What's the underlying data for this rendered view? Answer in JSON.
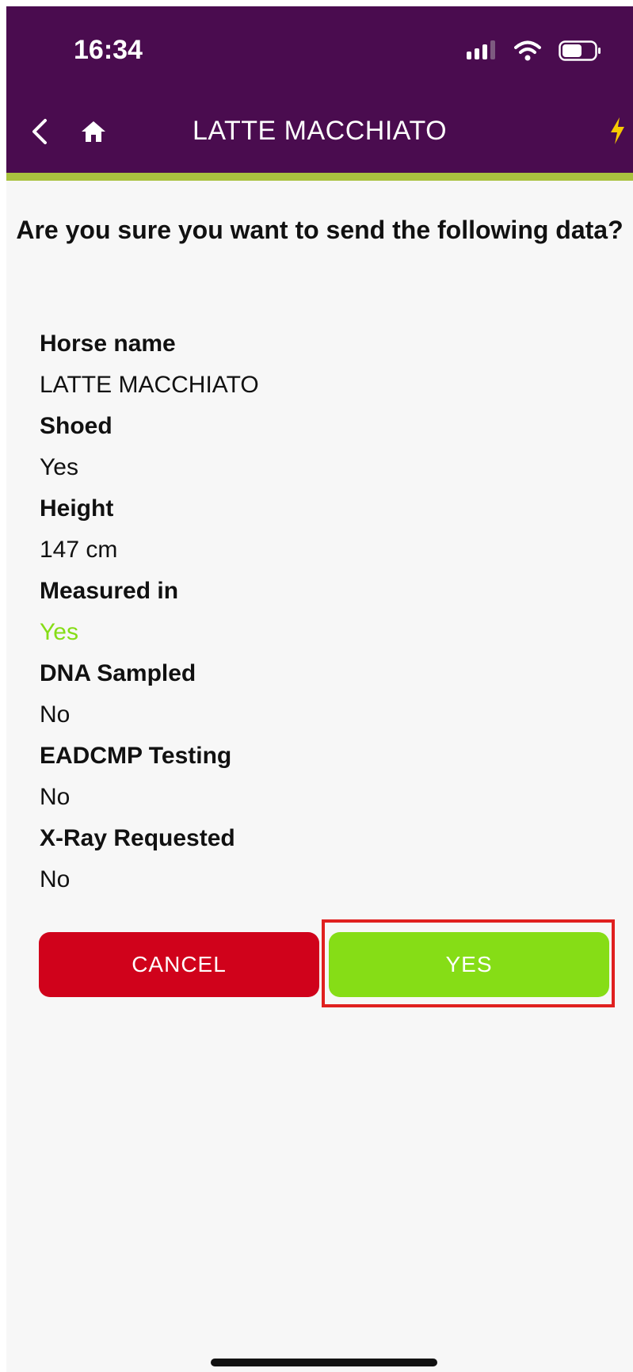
{
  "colors": {
    "header_bg": "#4a0c4f",
    "accent_line": "#a9c23f",
    "green": "#86dd16",
    "cancel_red": "#d0021b",
    "bolt_yellow": "#f7c900"
  },
  "status_bar": {
    "time": "16:34",
    "icons": [
      "cellular-signal-icon",
      "wifi-icon",
      "battery-icon"
    ]
  },
  "header": {
    "title": "LATTE MACCHIATO",
    "icons": [
      "back-chevron-icon",
      "home-icon",
      "lightning-bolt-icon"
    ]
  },
  "dialog": {
    "question": "Are you sure you want to send the following data?",
    "fields": [
      {
        "label": "Horse name",
        "value": "LATTE MACCHIATO"
      },
      {
        "label": "Shoed",
        "value": "Yes"
      },
      {
        "label": "Height",
        "value": "147 cm"
      },
      {
        "label": "Measured in",
        "value": "Yes",
        "highlight": true
      },
      {
        "label": "DNA Sampled",
        "value": "No"
      },
      {
        "label": "EADCMP Testing",
        "value": "No"
      },
      {
        "label": "X-Ray Requested",
        "value": "No"
      }
    ],
    "cancel_label": "CANCEL",
    "yes_label": "YES"
  }
}
